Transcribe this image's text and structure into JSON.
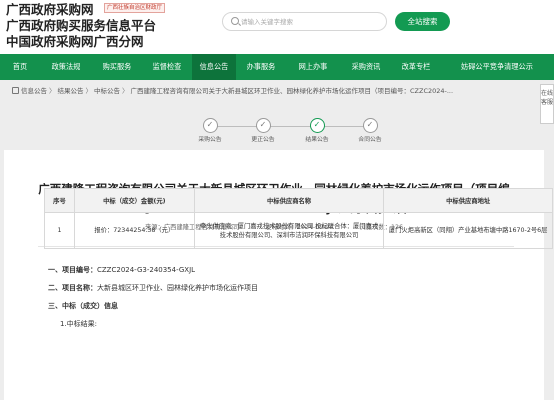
{
  "header": {
    "title_lines": [
      "广西政府采购网",
      "广西政府购买服务信息平台",
      "中国政府采购网广西分网"
    ],
    "tag": "广西壮族自治区财政厅",
    "search_placeholder": "请输入关键字搜索",
    "search_button": "全站搜索"
  },
  "nav": {
    "items": [
      "首页",
      "政策法规",
      "购买服务",
      "监督检查",
      "信息公告",
      "办事服务",
      "网上办事",
      "采购资讯",
      "改革专栏",
      "妨碍公平竞争清理公示"
    ],
    "active_index": 4
  },
  "breadcrumb": [
    "信息公告",
    "结果公告",
    "中标公告",
    "广西建隆工程咨询有限公司关于大新县城区环卫作业、园林绿化养护市场化运作项目（项目编号：CZZC2024-..."
  ],
  "side_button": "在线客服",
  "steps": [
    {
      "label": "采购公告",
      "active": false
    },
    {
      "label": "更正公告",
      "active": false
    },
    {
      "label": "结果公告",
      "active": true
    },
    {
      "label": "合同公告",
      "active": false
    }
  ],
  "article": {
    "title_line1": "广西建隆工程咨询有限公司关于大新县城区环卫作业、园林绿化养护市场化运作项目（项目编",
    "title_line2": "号：CZZC2024-G3-240354-GXJL）的中标公告",
    "source": "来源：广西建隆工程咨询有限公司",
    "date": "发布时间：2024-09-24",
    "views": "浏览次数：126",
    "sections": [
      {
        "num": "一、",
        "label": "项目编号：",
        "value": "CZZC2024-G3-240354-GXJL"
      },
      {
        "num": "二、",
        "label": "项目名称：",
        "value": "大新县城区环卫作业、园林绿化养护市场化运作项目"
      },
      {
        "num": "三、",
        "label": "中标（成交）信息",
        "value": ""
      }
    ],
    "sub_label": "1.中标结果:",
    "table": {
      "headers": [
        "序号",
        "中标（成交）金额(元)",
        "中标供应商名称",
        "中标供应商地址"
      ],
      "rows": [
        {
          "index": "1",
          "amount": "报价：72344254.38（元）",
          "supplier": "牵头供应商：厦门嘉戎技术股份有限公司 投标联合体：厦门嘉戎技术股份有限公司、深圳市洁润环保科技有限公司",
          "address": "厦门火炬高新区（同翔）产业基地布塘中路1670-2号6层"
        }
      ]
    }
  },
  "colors": {
    "brand_green": "#139a52",
    "nav_active": "#0d733b",
    "nav_bg": "#13914d"
  }
}
